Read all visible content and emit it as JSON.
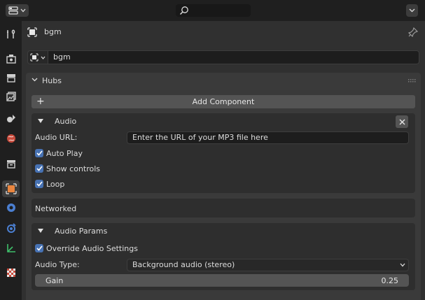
{
  "header": {
    "object_name": "bgm"
  },
  "name_field": {
    "value": "bgm"
  },
  "hubs_panel": {
    "title": "Hubs",
    "add_component_label": "Add Component"
  },
  "audio": {
    "title": "Audio",
    "url_label": "Audio URL:",
    "url_placeholder": "Enter the URL of your MP3 file here",
    "auto_play_label": "Auto Play",
    "auto_play_checked": true,
    "show_controls_label": "Show controls",
    "show_controls_checked": true,
    "loop_label": "Loop",
    "loop_checked": true
  },
  "networked": {
    "title": "Networked"
  },
  "audio_params": {
    "title": "Audio Params",
    "override_label": "Override Audio Settings",
    "override_checked": true,
    "type_label": "Audio Type:",
    "type_value": "Background audio (stereo)",
    "gain_label": "Gain",
    "gain_value": "0.25"
  },
  "colors": {
    "accent": "#4772b3",
    "active_tab_icon": "#e8853f",
    "window_bg": "#303030"
  },
  "icons": [
    "editor-type-icon",
    "search-icon",
    "chevron-down-icon",
    "tool-icon",
    "render-icon",
    "output-icon",
    "view-layer-icon",
    "scene-icon",
    "world-icon",
    "collection-icon",
    "object-icon",
    "modifier-icon",
    "physics-icon",
    "constraints-icon",
    "data-icon",
    "texture-icon",
    "pin-icon",
    "close-icon",
    "checkmark-icon"
  ]
}
